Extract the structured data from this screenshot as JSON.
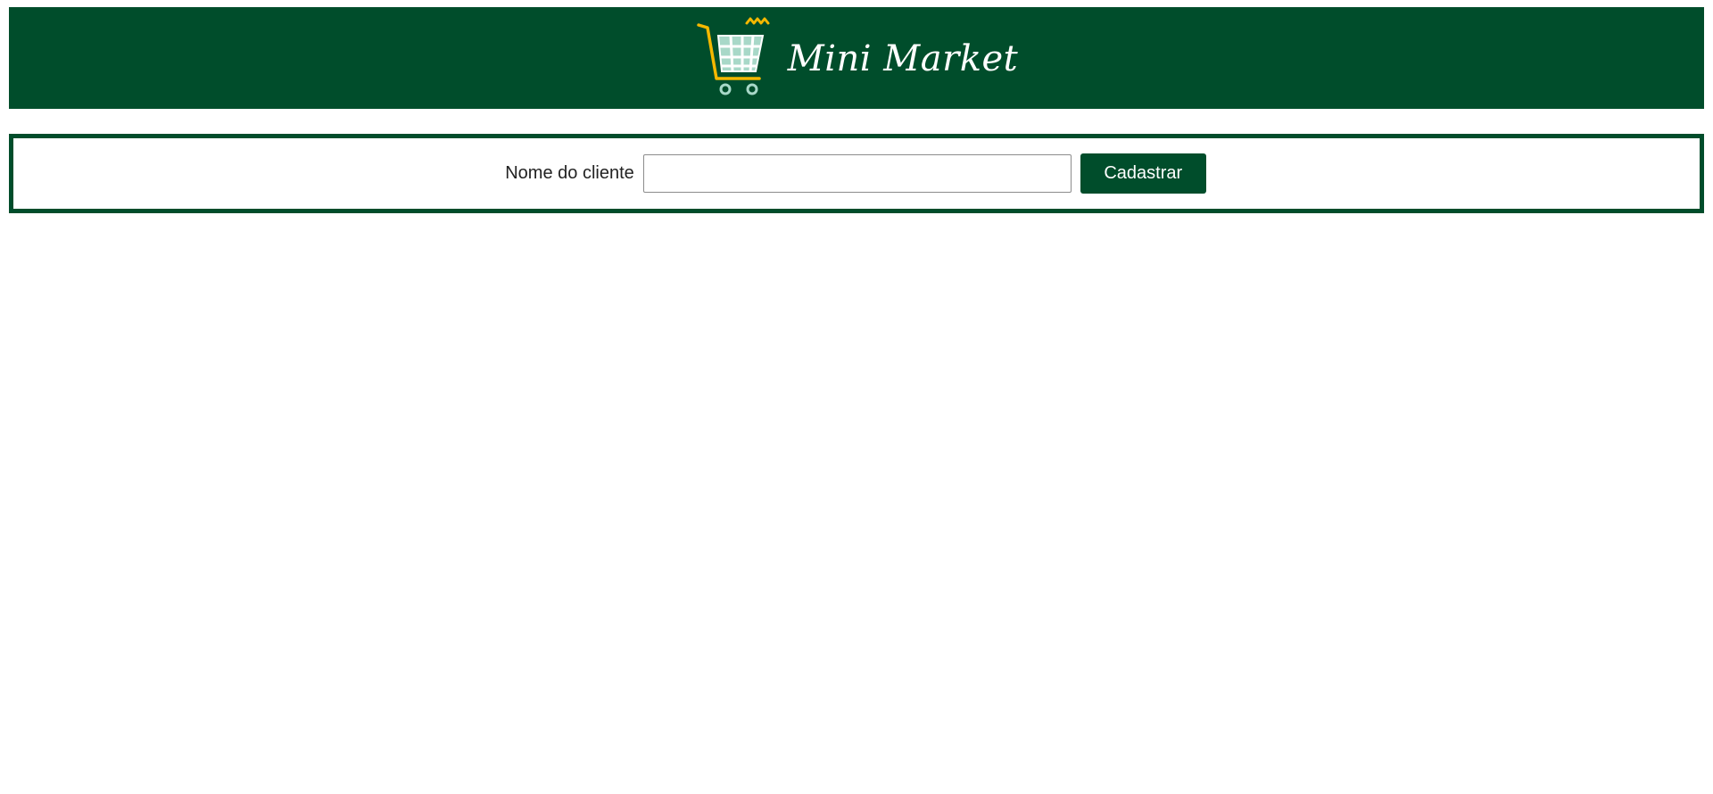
{
  "header": {
    "brand": "Mini Market",
    "logo_icon": "shopping-cart-icon",
    "background_color": "#004d2b",
    "accent_color": "#f5b800"
  },
  "form": {
    "label": "Nome do cliente",
    "input_value": "",
    "input_placeholder": "",
    "submit_label": "Cadastrar",
    "border_color": "#004d2b"
  }
}
